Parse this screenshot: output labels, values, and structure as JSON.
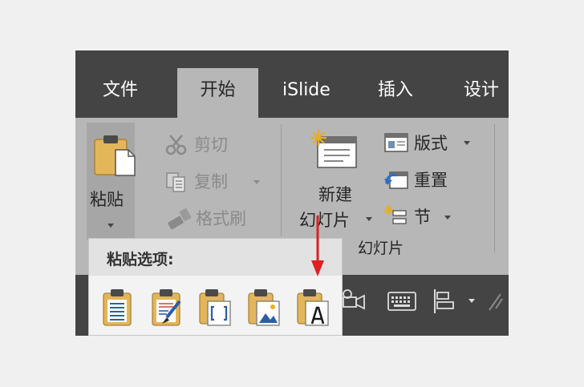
{
  "tabs": [
    {
      "label": "文件",
      "active": false
    },
    {
      "label": "开始",
      "active": true
    },
    {
      "label": "iSlide",
      "active": false
    },
    {
      "label": "插入",
      "active": false
    },
    {
      "label": "设计",
      "active": false
    }
  ],
  "clipboard": {
    "paste_label": "粘贴",
    "cut_label": "剪切",
    "copy_label": "复制",
    "format_painter_label": "格式刷"
  },
  "slides": {
    "new_slide_line1": "新建",
    "new_slide_line2": "幻灯片",
    "layout_label": "版式",
    "reset_label": "重置",
    "section_label": "节",
    "group_label": "幻灯片"
  },
  "paste_options": {
    "title": "粘贴选项:",
    "options": [
      {
        "icon": "paste-use-destination-theme-icon"
      },
      {
        "icon": "paste-keep-source-formatting-icon"
      },
      {
        "icon": "paste-embed-icon"
      },
      {
        "icon": "paste-picture-icon"
      },
      {
        "icon": "paste-keep-text-only-icon"
      }
    ]
  },
  "colors": {
    "tabbar": "#444444",
    "ribbon": "#b7b7b7",
    "popup": "#f3f3f3",
    "accent_arrow": "#e02020",
    "clipboard_gold": "#e3b65a"
  }
}
